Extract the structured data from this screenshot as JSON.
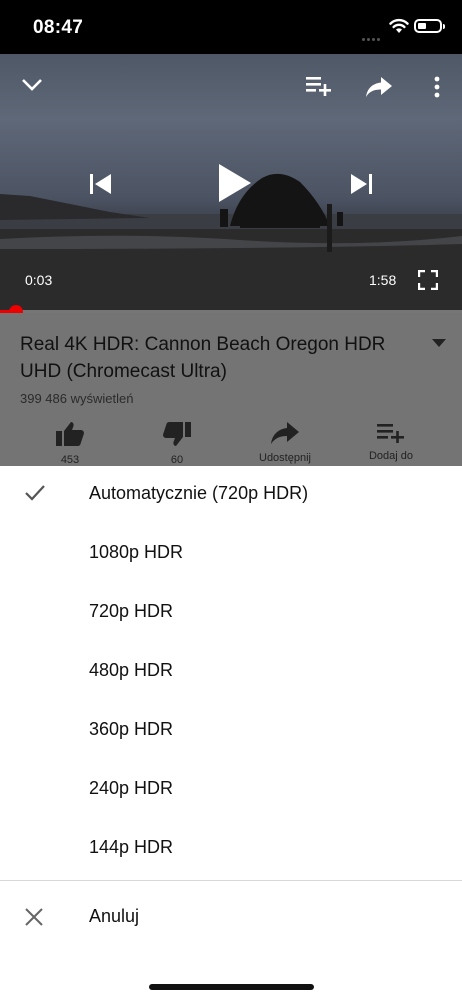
{
  "status_bar": {
    "time": "08:47"
  },
  "player": {
    "current_time": "0:03",
    "total_time": "1:58",
    "progress": 0.026
  },
  "video_info": {
    "title": "Real 4K HDR: Cannon Beach Oregon HDR UHD (Chromecast Ultra)",
    "views": "399 486 wyświetleń",
    "actions": [
      {
        "icon": "thumb-up-icon",
        "label": "453"
      },
      {
        "icon": "thumb-down-icon",
        "label": "60"
      },
      {
        "icon": "share-icon",
        "label": "Udostępnij"
      },
      {
        "icon": "add-to-playlist-icon",
        "label": "Dodaj do"
      }
    ]
  },
  "quality_menu": {
    "options": [
      {
        "label": "Automatycznie (720p HDR)",
        "selected": true
      },
      {
        "label": "1080p HDR",
        "selected": false
      },
      {
        "label": "720p HDR",
        "selected": false
      },
      {
        "label": "480p HDR",
        "selected": false
      },
      {
        "label": "360p HDR",
        "selected": false
      },
      {
        "label": "240p HDR",
        "selected": false
      },
      {
        "label": "144p HDR",
        "selected": false
      }
    ],
    "cancel_label": "Anuluj"
  },
  "colors": {
    "accent": "#ff0000",
    "sheet_background": "#ffffff",
    "overlay": "#747474"
  }
}
